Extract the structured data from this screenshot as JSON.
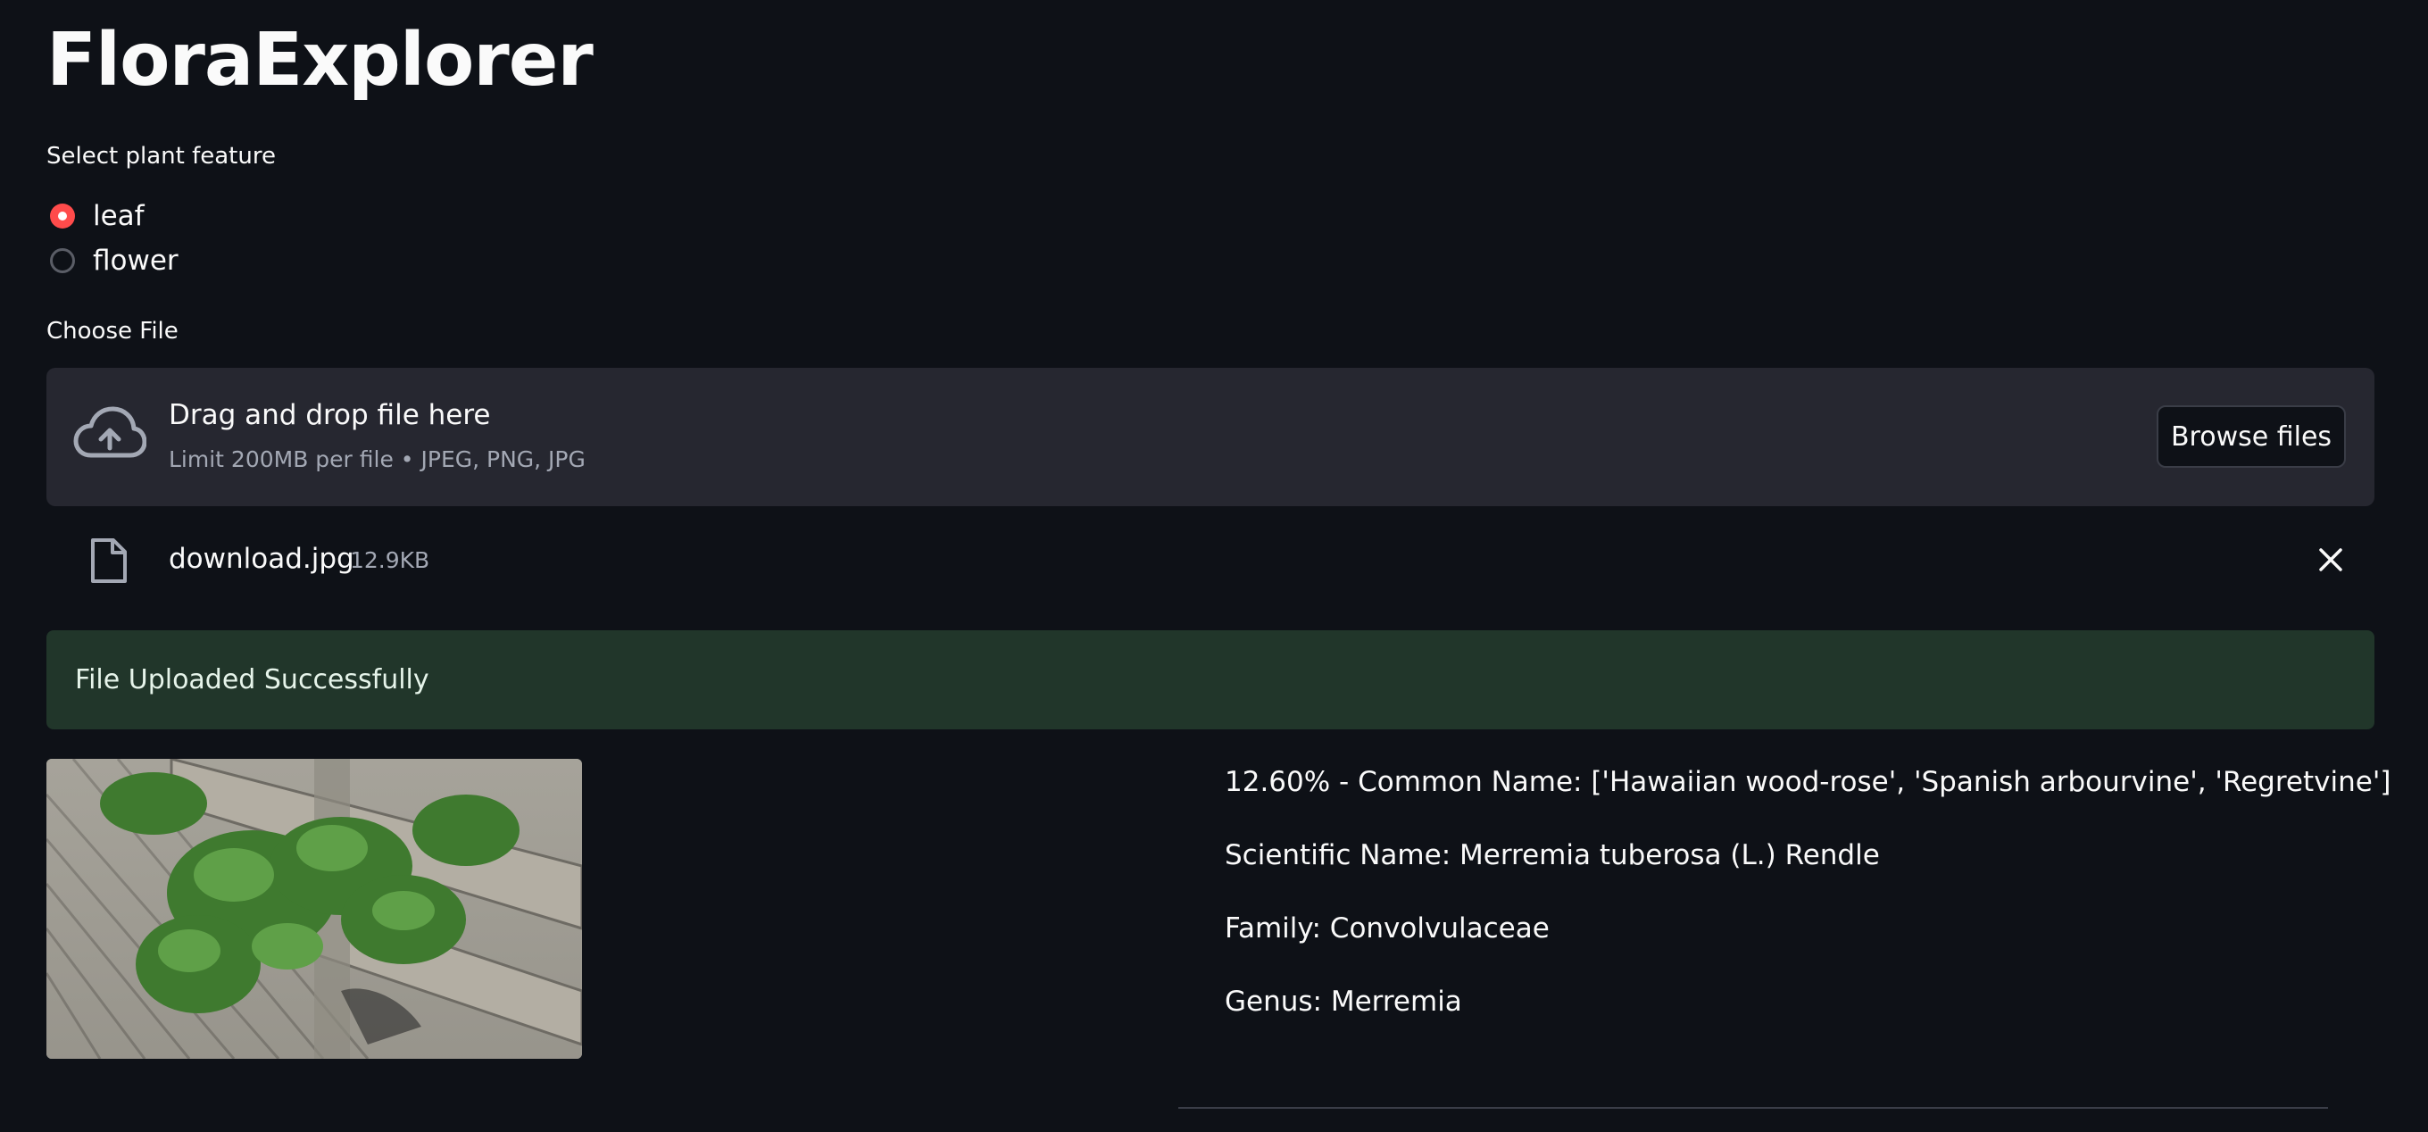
{
  "app": {
    "title": "FloraExplorer"
  },
  "feature_select": {
    "label": "Select plant feature",
    "options": [
      {
        "label": "leaf",
        "selected": true
      },
      {
        "label": "flower",
        "selected": false
      }
    ]
  },
  "uploader": {
    "label": "Choose File",
    "drop_text": "Drag and drop file here",
    "limit_text": "Limit 200MB per file • JPEG, PNG, JPG",
    "browse_label": "Browse files",
    "icon": "cloud-upload-icon"
  },
  "uploaded_file": {
    "name": "download.jpg",
    "size": "12.9KB",
    "icon": "file-icon"
  },
  "status": {
    "message": "File Uploaded Successfully",
    "color": "#21362a"
  },
  "results": {
    "prediction": "12.60% - Common Name: ['Hawaiian wood-rose', 'Spanish arbourvine', 'Regretvine']",
    "scientific": "Scientific Name: Merremia tuberosa (L.) Rendle",
    "family": "Family: Convolvulaceae",
    "genus": "Genus: Merremia"
  },
  "theme": {
    "background": "#0e1117",
    "accent": "#ff4b4b",
    "panel": "#262730"
  }
}
